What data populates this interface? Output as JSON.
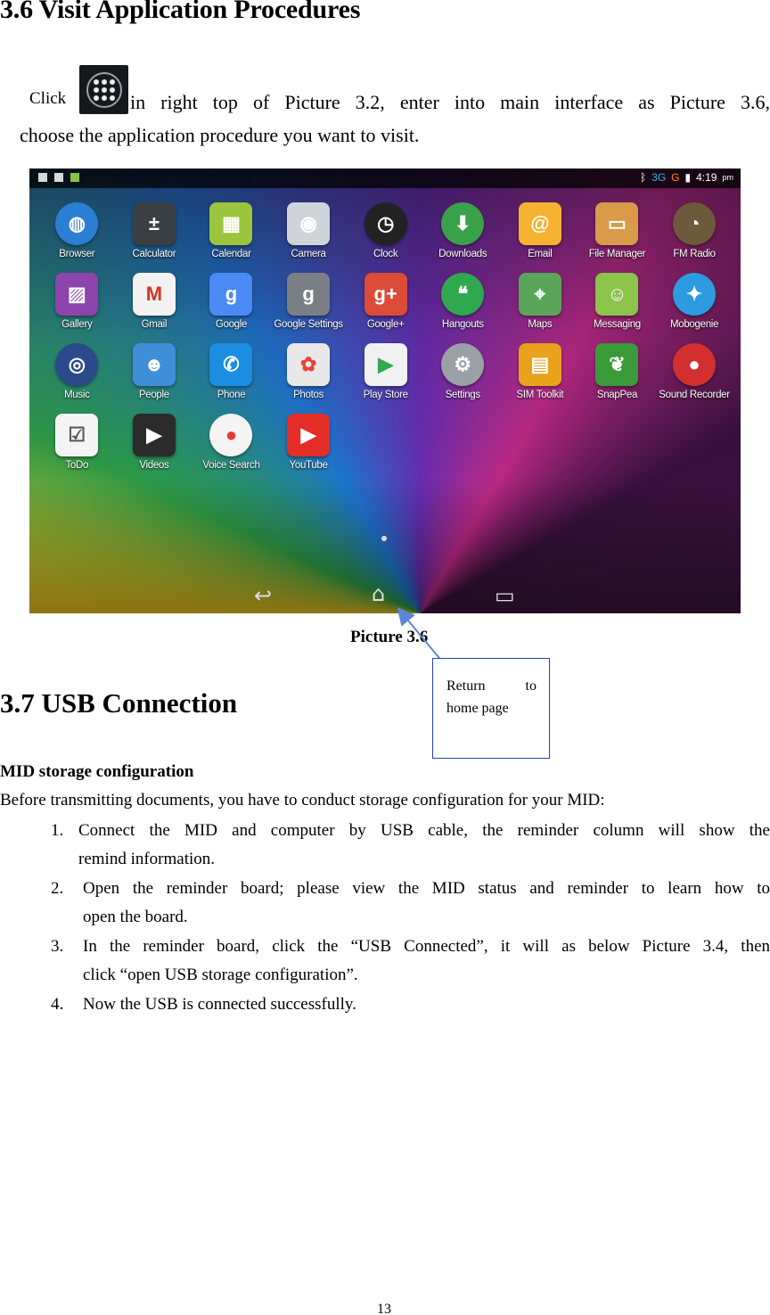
{
  "section1": {
    "title": "3.6 Visit Application Procedures",
    "click_word": "Click",
    "intro_line1_rest": "in right top of Picture 3.2, enter into main interface as Picture 3.6,",
    "intro_line2": "choose the application procedure you want to visit.",
    "figure_caption": "Picture 3.6",
    "callout_l1a": "Return",
    "callout_l1b": "to",
    "callout_l2": "home page"
  },
  "screenshot": {
    "status": {
      "net_3g": "3G",
      "net_g": "G",
      "time": "4:19",
      "ampm": "pm"
    },
    "apps": [
      {
        "label": "Browser",
        "icon": "globe-icon",
        "color": "#2a7fd4",
        "glyph": "◍",
        "round": true
      },
      {
        "label": "Calculator",
        "icon": "calculator-icon",
        "color": "#3a3f44",
        "glyph": "±"
      },
      {
        "label": "Calendar",
        "icon": "calendar-icon",
        "color": "#9bc53d",
        "glyph": "▦"
      },
      {
        "label": "Camera",
        "icon": "camera-icon",
        "color": "#cfd4d9",
        "glyph": "◉"
      },
      {
        "label": "Clock",
        "icon": "clock-icon",
        "color": "#222222",
        "glyph": "◷",
        "round": true
      },
      {
        "label": "Downloads",
        "icon": "download-icon",
        "color": "#3aa14b",
        "glyph": "⬇",
        "round": true
      },
      {
        "label": "Email",
        "icon": "email-icon",
        "color": "#f5b331",
        "glyph": "@"
      },
      {
        "label": "File Manager",
        "icon": "folder-icon",
        "color": "#d99a4a",
        "glyph": "▭"
      },
      {
        "label": "FM Radio",
        "icon": "radio-icon",
        "color": "#6d5a3c",
        "glyph": "◔",
        "round": true
      },
      {
        "label": "Gallery",
        "icon": "gallery-icon",
        "color": "#8e44ad",
        "glyph": "▨"
      },
      {
        "label": "Gmail",
        "icon": "gmail-icon",
        "color": "#f2f2f2",
        "glyph": "M",
        "fg": "#d93025"
      },
      {
        "label": "Google",
        "icon": "google-search-icon",
        "color": "#4a8af4",
        "glyph": "g"
      },
      {
        "label": "Google Settings",
        "icon": "google-settings-icon",
        "color": "#7a7f85",
        "glyph": "g"
      },
      {
        "label": "Google+",
        "icon": "google-plus-icon",
        "color": "#dd4b39",
        "glyph": "g+"
      },
      {
        "label": "Hangouts",
        "icon": "hangouts-icon",
        "color": "#2fa84f",
        "glyph": "❝",
        "round": true
      },
      {
        "label": "Maps",
        "icon": "maps-icon",
        "color": "#5aa55a",
        "glyph": "⌖"
      },
      {
        "label": "Messaging",
        "icon": "messaging-icon",
        "color": "#8cc34b",
        "glyph": "☺"
      },
      {
        "label": "Mobogenie",
        "icon": "mobogenie-icon",
        "color": "#2c9be0",
        "glyph": "✦",
        "round": true
      },
      {
        "label": "Music",
        "icon": "music-icon",
        "color": "#2b4a8a",
        "glyph": "◎",
        "round": true
      },
      {
        "label": "People",
        "icon": "people-icon",
        "color": "#3f8ed8",
        "glyph": "☻"
      },
      {
        "label": "Phone",
        "icon": "phone-icon",
        "color": "#1c8de0",
        "glyph": "✆"
      },
      {
        "label": "Photos",
        "icon": "photos-icon",
        "color": "#e8e8e8",
        "glyph": "✿",
        "fg": "#e94235"
      },
      {
        "label": "Play Store",
        "icon": "play-store-icon",
        "color": "#f1f1f1",
        "glyph": "▶",
        "fg": "#34a853"
      },
      {
        "label": "Settings",
        "icon": "settings-icon",
        "color": "#9aa0a6",
        "glyph": "⚙",
        "round": true
      },
      {
        "label": "SIM Toolkit",
        "icon": "sim-icon",
        "color": "#e8a21c",
        "glyph": "▤"
      },
      {
        "label": "SnapPea",
        "icon": "snappea-icon",
        "color": "#3a9a3a",
        "glyph": "❦"
      },
      {
        "label": "Sound Recorder",
        "icon": "microphone-icon",
        "color": "#d32f2f",
        "glyph": "●",
        "round": true
      },
      {
        "label": "ToDo",
        "icon": "todo-icon",
        "color": "#f4f4f4",
        "glyph": "☑",
        "fg": "#555555"
      },
      {
        "label": "Videos",
        "icon": "video-icon",
        "color": "#2b2b2b",
        "glyph": "▶"
      },
      {
        "label": "Voice Search",
        "icon": "voice-search-icon",
        "color": "#f4f4f4",
        "glyph": "●",
        "fg": "#e53935",
        "round": true
      },
      {
        "label": "YouTube",
        "icon": "youtube-icon",
        "color": "#e52d27",
        "glyph": "▶"
      }
    ]
  },
  "section2": {
    "title": "3.7 USB Connection",
    "subtitle": "MID storage configuration",
    "intro": "Before transmitting documents, you have to conduct storage configuration for your MID:",
    "items": [
      {
        "num": "1.",
        "line1": "Connect the MID and computer by USB cable, the reminder column will show the",
        "line2": "remind information."
      },
      {
        "num": "2.",
        "line1": "Open the reminder board; please view the MID status and reminder to learn how to",
        "line2": "open the board."
      },
      {
        "num": "3.",
        "line1": "In the reminder board, click the “USB Connected”, it will as below Picture 3.4, then",
        "line2": "click “open USB storage configuration”."
      },
      {
        "num": "4.",
        "line1": "Now the USB is connected successfully.",
        "line2": ""
      }
    ]
  },
  "page_number": "13"
}
